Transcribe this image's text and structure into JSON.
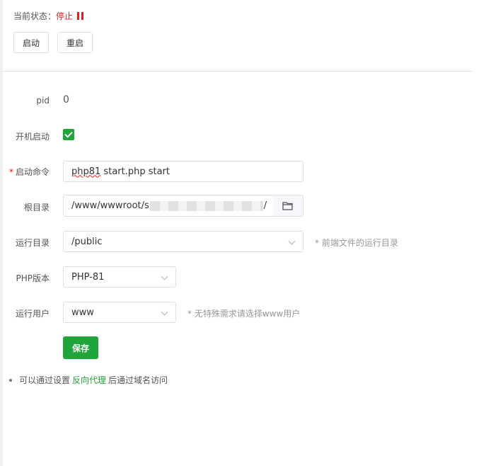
{
  "status": {
    "label": "当前状态：",
    "value": "停止",
    "icon": "pause-icon"
  },
  "actions": {
    "start_label": "启动",
    "restart_label": "重启"
  },
  "form": {
    "pid": {
      "label": "pid",
      "value": "0"
    },
    "autostart": {
      "label": "开机启动",
      "checked": true
    },
    "start_command": {
      "label": "启动命令",
      "required_mark": "*",
      "value_underlined": "php81",
      "value_rest": " start.php start"
    },
    "root_dir": {
      "label": "根目录",
      "value_prefix": "/www/wwwroot/s",
      "value_suffix": "/",
      "button_icon": "folder-icon"
    },
    "run_dir": {
      "label": "运行目录",
      "value": "/public",
      "hint": "* 前端文件的运行目录"
    },
    "php_version": {
      "label": "PHP版本",
      "value": "PHP-81"
    },
    "run_user": {
      "label": "运行用户",
      "value": "www",
      "hint": "* 无特殊需求请选择www用户"
    },
    "save_label": "保存"
  },
  "note": {
    "prefix": "可以通过设置",
    "link": "反向代理",
    "suffix": "后通过域名访问"
  },
  "colors": {
    "accent": "#20a53a",
    "danger": "#e02020"
  }
}
